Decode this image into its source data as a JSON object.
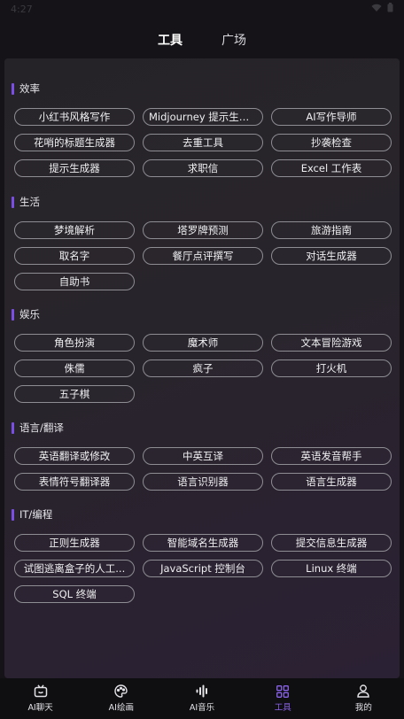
{
  "status_bar": {
    "time": "4:27"
  },
  "top_tabs": [
    {
      "label": "工具",
      "active": true
    },
    {
      "label": "广场",
      "active": false
    }
  ],
  "sections": [
    {
      "title": "效率",
      "items": [
        "小红书风格写作",
        "Midjourney 提示生成器",
        "AI写作导师",
        "花哨的标题生成器",
        "去重工具",
        "抄袭检查",
        "提示生成器",
        "求职信",
        "Excel 工作表"
      ]
    },
    {
      "title": "生活",
      "items": [
        "梦境解析",
        "塔罗牌预测",
        "旅游指南",
        "取名字",
        "餐厅点评撰写",
        "对话生成器",
        "自助书"
      ]
    },
    {
      "title": "娱乐",
      "items": [
        "角色扮演",
        "魔术师",
        "文本冒险游戏",
        "侏儒",
        "疯子",
        "打火机",
        "五子棋"
      ]
    },
    {
      "title": "语言/翻译",
      "items": [
        "英语翻译或修改",
        "中英互译",
        "英语发音帮手",
        "表情符号翻译器",
        "语言识别器",
        "语言生成器"
      ]
    },
    {
      "title": "IT/编程",
      "items": [
        "正则生成器",
        "智能域名生成器",
        "提交信息生成器",
        "试图逃离盒子的人工...",
        "JavaScript 控制台",
        "Linux 终端",
        "SQL 终端"
      ]
    }
  ],
  "bottom_nav": [
    {
      "label": "AI聊天",
      "icon": "tv-robot-icon",
      "active": false
    },
    {
      "label": "AI绘画",
      "icon": "palette-icon",
      "active": false
    },
    {
      "label": "AI音乐",
      "icon": "audio-wave-icon",
      "active": false
    },
    {
      "label": "工具",
      "icon": "grid-icon",
      "active": true
    },
    {
      "label": "我的",
      "icon": "person-icon",
      "active": false
    }
  ],
  "colors": {
    "accent": "#7b4fe6",
    "nav_active": "#8a63ea",
    "chip_border": "#8d8d93"
  }
}
